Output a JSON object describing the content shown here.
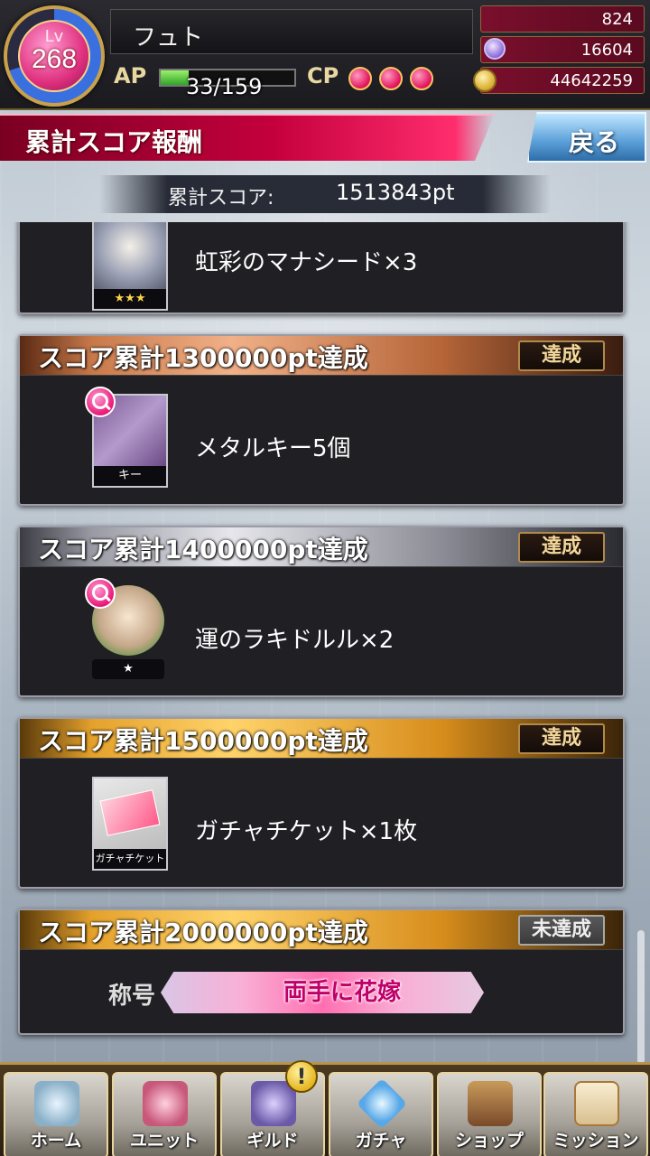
{
  "player": {
    "level_label": "Lv",
    "level": "268",
    "name": "フュト",
    "ap_label": "AP",
    "ap_text": "33/159",
    "ap_fraction": 0.21,
    "cp_label": "CP",
    "cp_count": 3
  },
  "currencies": [
    {
      "icon": "blue-gem-icon",
      "value": "824"
    },
    {
      "icon": "purple-gem-icon",
      "value": "16604"
    },
    {
      "icon": "gold-coin-icon",
      "value": "44642259"
    }
  ],
  "header": {
    "title": "累計スコア報酬",
    "back_label": "戻る"
  },
  "score": {
    "label": "累計スコア:",
    "value": "1513843pt"
  },
  "rewards": [
    {
      "title": "",
      "status": "",
      "item": "虹彩のマナシード×3",
      "caption": "★★★"
    },
    {
      "title": "スコア累計1300000pt達成",
      "status": "達成",
      "item": "メタルキー5個",
      "caption": "キー"
    },
    {
      "title": "スコア累計1400000pt達成",
      "status": "達成",
      "item": "運のラキドルル×2",
      "caption": "★"
    },
    {
      "title": "スコア累計1500000pt達成",
      "status": "達成",
      "item": "ガチャチケット×1枚",
      "caption": "ガチャチケット"
    },
    {
      "title": "スコア累計2000000pt達成",
      "status": "未達成",
      "emblem_label": "称号",
      "emblem_text": "両手に花嫁"
    }
  ],
  "nav": {
    "home": "ホーム",
    "unit": "ユニット",
    "guild": "ギルド",
    "gacha": "ガチャ",
    "shop": "ショップ",
    "mission": "ミッション",
    "notify": "!"
  },
  "colors": {
    "accent_red": "#c4003c",
    "badge_gold": "#f3d79a",
    "ap_green": "#2ea52a"
  }
}
